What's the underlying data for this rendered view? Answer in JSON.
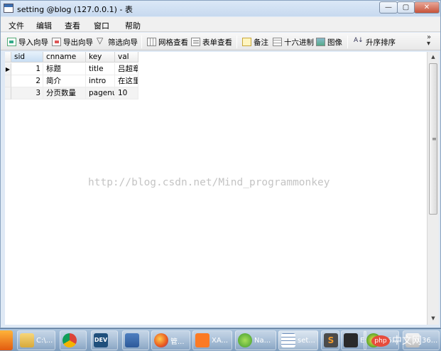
{
  "window": {
    "title": "setting @blog (127.0.0.1) - 表"
  },
  "window_controls": {
    "minimize": "—",
    "maximize": "▢",
    "close": "✕"
  },
  "menu": [
    "文件",
    "编辑",
    "查看",
    "窗口",
    "帮助"
  ],
  "toolbar": {
    "import_wizard": "导入向导",
    "export_wizard": "导出向导",
    "filter_wizard": "筛选向导",
    "grid_view": "网格查看",
    "form_view": "表单查看",
    "memo": "备注",
    "hex": "十六进制",
    "image": "图像",
    "sort": "升序排序",
    "more": "»"
  },
  "table": {
    "columns": [
      "sid",
      "cnname",
      "key",
      "val"
    ],
    "rows": [
      {
        "sid": "1",
        "cnname": "标题",
        "key": "title",
        "val": "吕超章的"
      },
      {
        "sid": "2",
        "cnname": "简介",
        "key": "intro",
        "val": "在这里储"
      },
      {
        "sid": "3",
        "cnname": "分页数量",
        "key": "pagenu",
        "val": "10"
      }
    ],
    "current_row_marker": "▶"
  },
  "watermark": "http://blog.csdn.net/Mind_programmonkey",
  "taskbar": {
    "items": [
      {
        "label": "C:\\...",
        "icon": "folder-icon"
      },
      {
        "label": "",
        "icon": "chrome-icon"
      },
      {
        "label": "DEV",
        "icon": "dev-icon"
      },
      {
        "label": "",
        "icon": "app-icon"
      },
      {
        "label": "",
        "icon": "firefox-icon"
      },
      {
        "label": "管...",
        "icon": "app-icon"
      },
      {
        "label": "XA...",
        "icon": "xampp-icon"
      },
      {
        "label": "Na...",
        "icon": "navicat-icon"
      },
      {
        "label": "set...",
        "icon": "table-icon"
      },
      {
        "label": "S",
        "icon": "sublime-icon"
      },
      {
        "label": "E:\\...",
        "icon": "explorer-icon"
      },
      {
        "label": "36...",
        "icon": "plus-icon"
      },
      {
        "label": "36...",
        "icon": "camera-icon"
      }
    ],
    "tray_text": "中文网",
    "tray_badge": "php"
  }
}
